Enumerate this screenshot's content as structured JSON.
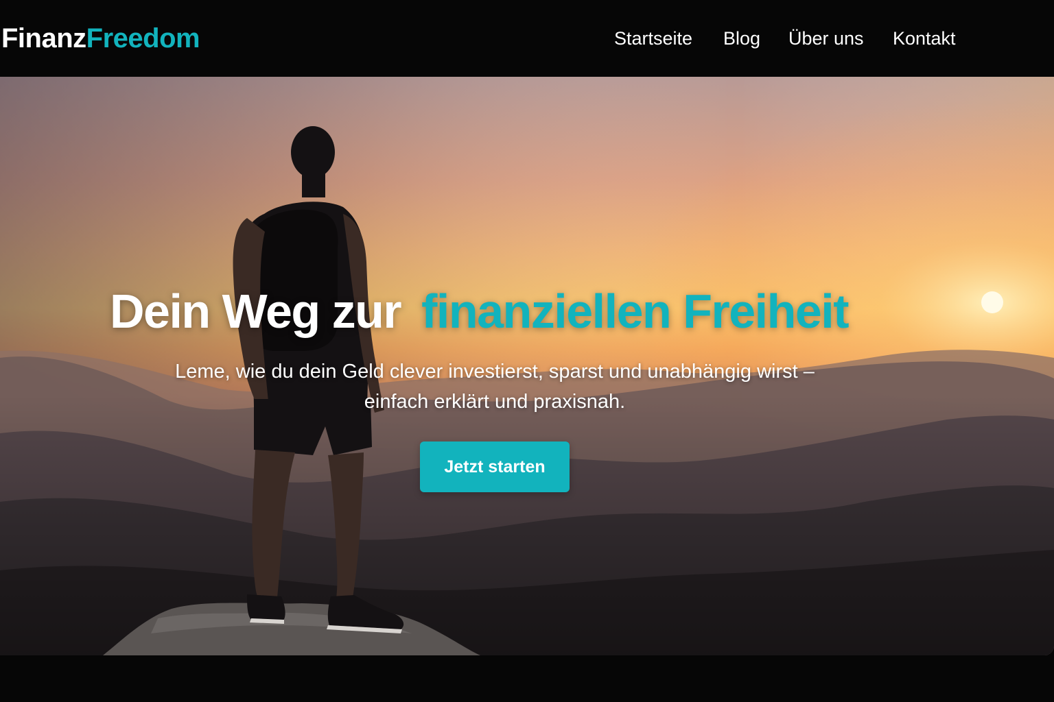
{
  "header": {
    "logo_part1": "Finanz",
    "logo_part2": "Freedom",
    "nav": [
      {
        "label": "Startseite"
      },
      {
        "label": "Blog"
      },
      {
        "label": "Über uns"
      },
      {
        "label": "Kontakt"
      }
    ]
  },
  "hero": {
    "headline_part1": "Dein Weg zur",
    "headline_part2": "finanziellen Freiheit",
    "subline_line1": "Leme, wie du dein Geld clever investierst, sparst und unabhängig wirst –",
    "subline_line2": "einfach erklärt und praxisnah.",
    "cta_label": "Jetzt starten",
    "background_description_icon": "hiker-sunset-mountains-image"
  },
  "colors": {
    "accent": "#12b3bd",
    "header_bg": "#060606",
    "text": "#ffffff"
  }
}
